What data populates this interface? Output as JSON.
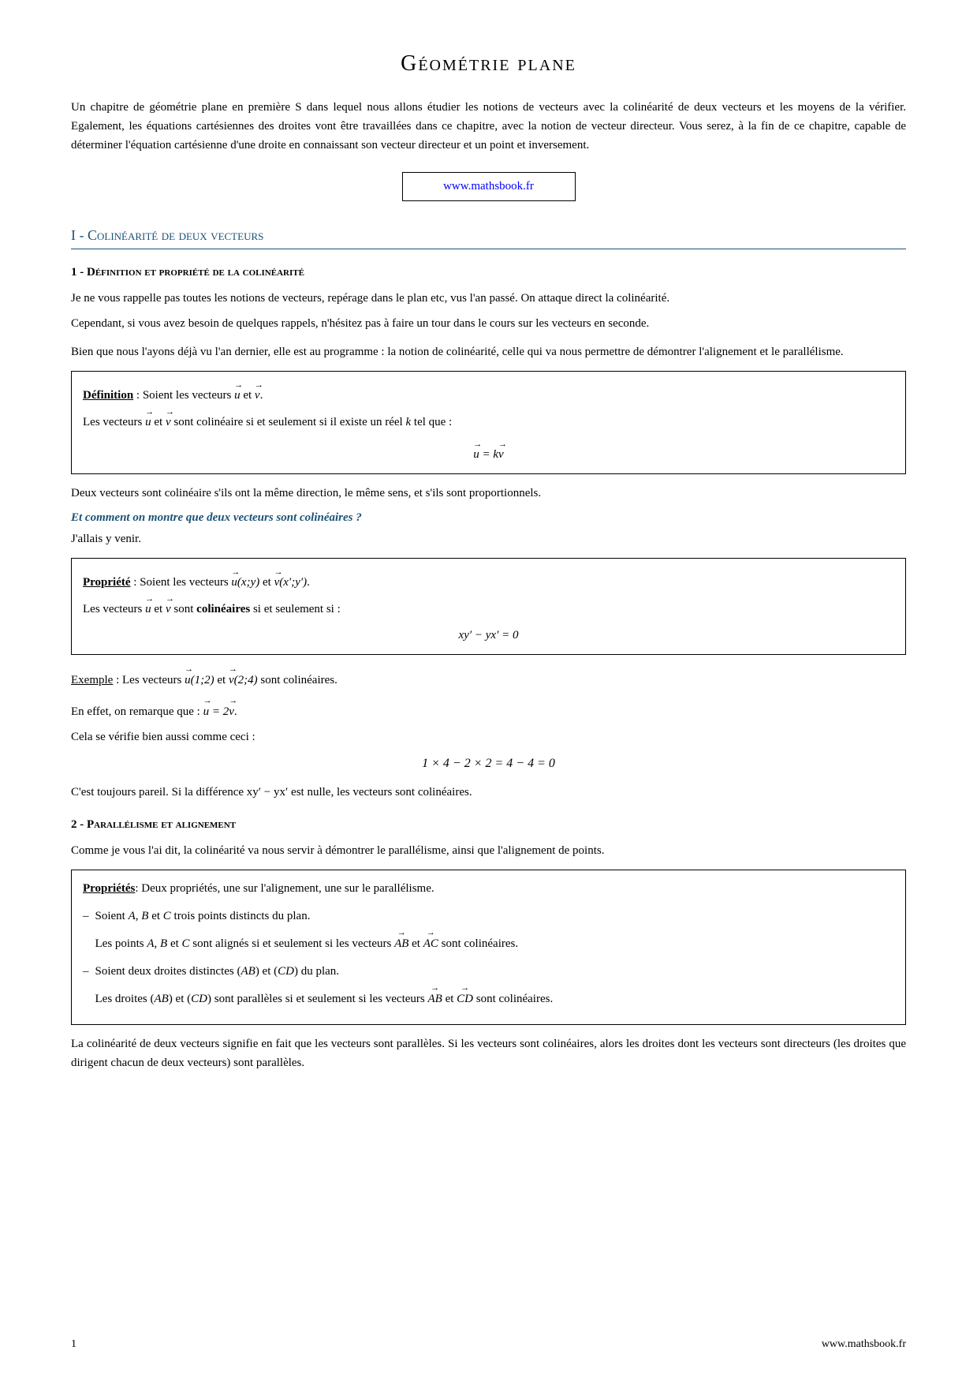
{
  "page": {
    "title": "Géométrie plane",
    "intro": "Un chapitre de géométrie plane en première S dans lequel nous allons étudier les notions de vecteurs avec la colinéarité de deux vecteurs et les moyens de la vérifier. Egalement, les équations cartésiennes des droites vont être travaillées dans ce chapitre, avec la notion de vecteur directeur. Vous serez, à la fin de ce chapitre, capable de déterminer l'équation cartésienne d'une droite en connaissant son vecteur directeur et un point et inversement.",
    "website": "www.mathsbook.fr",
    "section1_title": "I - Colinéarité de deux vecteurs",
    "subsection1_title": "1 - Définition et propriété de la colinéarité",
    "subsection1_p1": "Je ne vous rappelle pas toutes les notions de vecteurs, repérage dans le plan etc, vus l'an passé. On attaque direct la colinéarité.",
    "subsection1_p2": "Cependant, si vous avez besoin de quelques rappels, n'hésitez pas à faire un tour dans le cours sur les vecteurs en seconde.",
    "subsection1_p3": "Bien que nous l'ayons déjà vu l'an dernier, elle est au programme : la notion de colinéarité, celle qui va nous permettre de démontrer l'alignement et le parallélisme.",
    "definition_label": "Définition",
    "definition_text1": ": Soient les vecteurs",
    "definition_text2": "et",
    "definition_text3": "Les vecteurs",
    "definition_text4": "et",
    "definition_text5": "sont colinéaire si et seulement si il existe un réel k tel que :",
    "definition_formula": "u⃗ = k v⃗",
    "colineaire_text": "Deux vecteurs sont colinéaire s'ils ont la même direction, le même sens, et s'ils sont proportionnels.",
    "italic_question": "Et comment on montre que deux vecteurs sont colinéaires ?",
    "italic_answer": "J'allais y venir.",
    "propriete_label": "Propriété",
    "propriete_text1": ": Soient les vecteurs",
    "propriete_text2": "et",
    "propriete_text3": "Les vecteurs",
    "propriete_text4": "et",
    "propriete_text5": "sont",
    "propriete_bold": "colinéaires",
    "propriete_text6": "si et seulement si :",
    "propriete_formula": "xy′ − yx′ = 0",
    "exemple_label": "Exemple",
    "exemple_text": ": Les vecteurs",
    "exemple_text2": "et",
    "exemple_text3": "sont colinéaires.",
    "exemple_remark": "En effet, on remarque que :",
    "exemple_remark2": "Cela se vérifie bien aussi comme ceci :",
    "exemple_formula": "1 × 4 − 2 × 2 = 4 − 4 = 0",
    "exemple_remark_formula": "u⃗ = 2v⃗",
    "cest_toujours": "C'est toujours pareil. Si la différence xy′ − yx′ est nulle, les vecteurs sont colinéaires.",
    "subsection2_title": "2 - Parallélisme et alignement",
    "subsection2_p1": "Comme je vous l'ai dit, la colinéarité va nous servir à démontrer le parallélisme, ainsi que l'alignement de points.",
    "proprietes_label": "Propriétés",
    "proprietes_text": ": Deux propriétés, une sur l'alignement, une sur le parallélisme.",
    "prop_item1_title": "Soient A, B et C trois points distincts du plan.",
    "prop_item1_text": "Les points A, B et C sont alignés si et seulement si les vecteurs",
    "prop_item1_AB": "AB",
    "prop_item1_and": "et",
    "prop_item1_AC": "AC",
    "prop_item1_end": "sont colinéaires.",
    "prop_item2_title": "Soient deux droites distinctes (AB) et (CD) du plan.",
    "prop_item2_text": "Les droites (AB) et (CD) sont parallèles si et seulement si les vecteurs",
    "prop_item2_AB": "AB",
    "prop_item2_and": "et",
    "prop_item2_CD": "CD",
    "prop_item2_end": "sont colinéaires.",
    "conclusion_text": "La colinéarité de deux vecteurs signifie en fait que les vecteurs sont parallèles. Si les vecteurs sont colinéaires, alors les droites dont les vecteurs sont directeurs (les droites que dirigent chacun de deux vecteurs) sont parallèles.",
    "footer_page": "1",
    "footer_website": "www.mathsbook.fr"
  }
}
